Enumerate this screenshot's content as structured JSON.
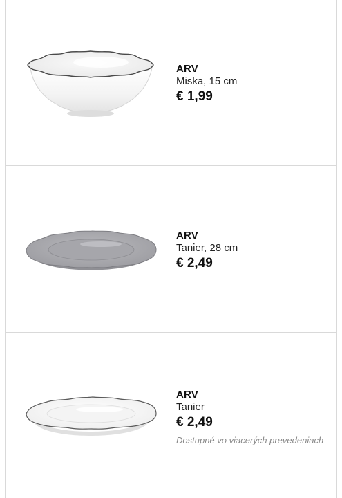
{
  "products": [
    {
      "name": "ARV",
      "description": "Miska, 15 cm",
      "price": "€ 1,99",
      "image_icon": "white-bowl-image",
      "color": "#ffffff"
    },
    {
      "name": "ARV",
      "description": "Tanier, 28 cm",
      "price": "€ 2,49",
      "image_icon": "grey-plate-image",
      "color": "#a9a9ad"
    },
    {
      "name": "ARV",
      "description": "Tanier",
      "price": "€ 2,49",
      "note": "Dostupné vo viacerých prevedeniach",
      "image_icon": "white-plate-image",
      "color": "#ffffff"
    }
  ]
}
